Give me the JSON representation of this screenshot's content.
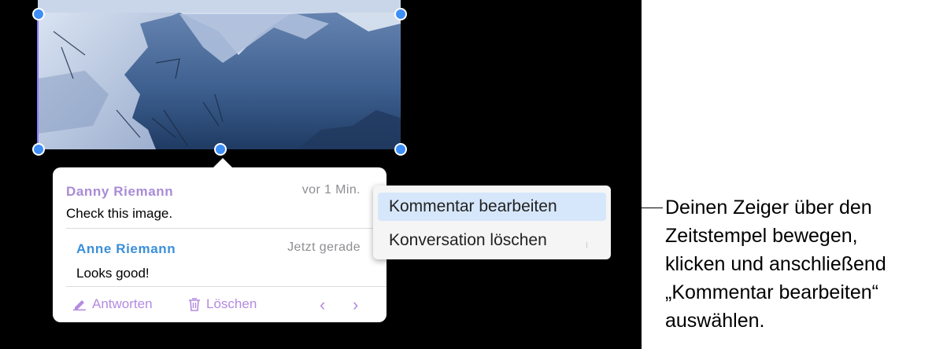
{
  "comments": [
    {
      "author": "Danny Riemann",
      "time": "vor 1 Min.",
      "text": "Check this image."
    },
    {
      "author": "Anne Riemann",
      "time": "Jetzt gerade",
      "text": "Looks good!"
    }
  ],
  "actions": {
    "reply_label": "Antworten",
    "delete_label": "Löschen",
    "prev_label": "‹",
    "next_label": "›"
  },
  "context_menu": {
    "items": [
      "Kommentar bearbeiten",
      "Konversation löschen"
    ],
    "highlighted_index": 0
  },
  "callout": {
    "lines": [
      "Deinen Zeiger über den",
      "Zeitstempel bewegen,",
      "klicken und anschließend",
      "„Kommentar bearbeiten“",
      "auswählen."
    ]
  },
  "colors": {
    "author_1": "#a98bd6",
    "author_2": "#3a8fd9",
    "action": "#b48ae0",
    "selection_handle": "#3d8ef7",
    "menu_highlight": "#d6e7fb"
  }
}
